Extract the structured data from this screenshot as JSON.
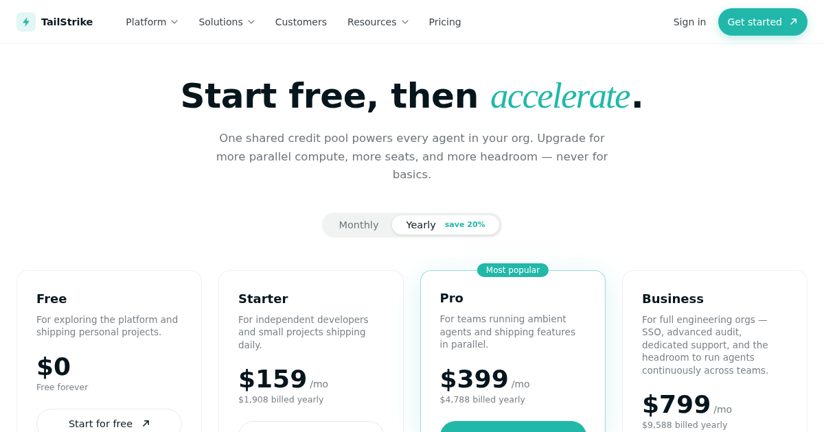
{
  "nav": {
    "brand": "TailStrike",
    "links": [
      {
        "label": "Platform",
        "dropdown": true
      },
      {
        "label": "Solutions",
        "dropdown": true
      },
      {
        "label": "Customers",
        "dropdown": false
      },
      {
        "label": "Resources",
        "dropdown": true
      },
      {
        "label": "Pricing",
        "dropdown": false
      }
    ],
    "sign_in": "Sign in",
    "cta": "Get started"
  },
  "hero": {
    "headline": "Start free, then *accelerate*.",
    "subtitle": "One shared credit pool powers every agent in your org. Upgrade for more parallel compute, more seats, and more headroom — never for basics."
  },
  "billing_toggle": {
    "options": [
      {
        "label": "Monthly",
        "selected": false
      },
      {
        "label": "Yearly",
        "selected": true,
        "badge": "save 20%"
      }
    ]
  },
  "plans": [
    {
      "name": "Free",
      "description": "For exploring the platform and shipping personal projects.",
      "price": "$0",
      "note": "Free forever",
      "featured": false,
      "button": {
        "kind": "outline",
        "label": "Start for free"
      }
    },
    {
      "name": "Starter",
      "description": "For independent developers and small projects shipping daily.",
      "price": "$159",
      "period": "/mo",
      "note": "$1,908 billed yearly",
      "featured": false,
      "button": {
        "kind": "outline"
      }
    },
    {
      "name": "Pro",
      "badge": "Most popular",
      "description": "For teams running ambient agents and shipping features in parallel.",
      "price": "$399",
      "period": "/mo",
      "note": "$4,788 billed yearly",
      "featured": true,
      "button": {
        "kind": "filled"
      }
    },
    {
      "name": "Business",
      "description": "For full engineering orgs — SSO, advanced audit, dedicated support, and the headroom to run agents continuously across teams.",
      "price": "$799",
      "period": "/mo",
      "note": "$9,588 billed yearly",
      "featured": false
    }
  ]
}
